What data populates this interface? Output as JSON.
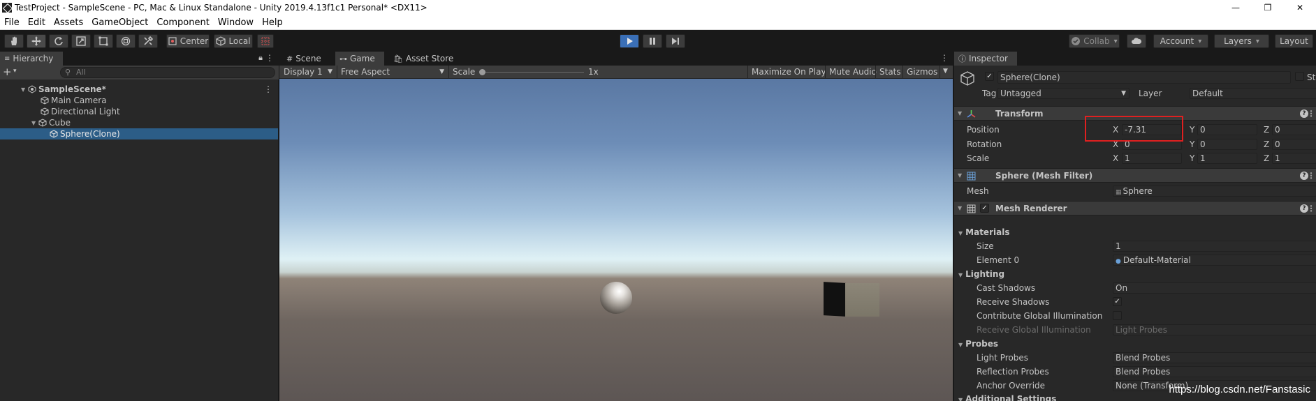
{
  "window": {
    "title": "TestProject - SampleScene - PC, Mac & Linux Standalone - Unity 2019.4.13f1c1 Personal* <DX11>",
    "minimize": "—",
    "restore": "❐",
    "close": "✕"
  },
  "menu": [
    "File",
    "Edit",
    "Assets",
    "GameObject",
    "Component",
    "Window",
    "Help"
  ],
  "toolbar": {
    "pivot_label": "Center",
    "space_label": "Local",
    "collab_label": "Collab",
    "account_label": "Account",
    "layers_label": "Layers",
    "layout_label": "Layout"
  },
  "hierarchy": {
    "tab_label": "Hierarchy",
    "search_placeholder": "All",
    "items": [
      {
        "label": "SampleScene*",
        "depth": 0
      },
      {
        "label": "Main Camera",
        "depth": 1
      },
      {
        "label": "Directional Light",
        "depth": 1
      },
      {
        "label": "Cube",
        "depth": 1
      },
      {
        "label": "Sphere(Clone)",
        "depth": 2,
        "selected": true
      }
    ]
  },
  "center": {
    "tabs": [
      "Scene",
      "Game",
      "Asset Store"
    ],
    "display": "Display 1",
    "aspect": "Free Aspect",
    "scale_label": "Scale",
    "scale_value": "1x",
    "maximize": "Maximize On Play",
    "mute": "Mute Audio",
    "stats": "Stats",
    "gizmos": "Gizmos"
  },
  "inspector": {
    "tab_label": "Inspector",
    "object_name": "Sphere(Clone)",
    "static_label": "St",
    "tag_label": "Tag",
    "tag_value": "Untagged",
    "layer_label": "Layer",
    "layer_value": "Default",
    "transform": {
      "title": "Transform",
      "position_label": "Position",
      "rotation_label": "Rotation",
      "scale_label": "Scale",
      "axis_x": "X",
      "axis_y": "Y",
      "axis_z": "Z",
      "position": [
        "-7.31",
        "0",
        "0"
      ],
      "rotation": [
        "0",
        "0",
        "0"
      ],
      "scale": [
        "1",
        "1",
        "1"
      ]
    },
    "mesh_filter": {
      "title": "Sphere (Mesh Filter)",
      "mesh_label": "Mesh",
      "mesh_value": "Sphere"
    },
    "mesh_renderer": {
      "title": "Mesh Renderer",
      "materials_label": "Materials",
      "size_label": "Size",
      "size_value": "1",
      "element0_label": "Element 0",
      "element0_value": "Default-Material",
      "lighting_label": "Lighting",
      "cast_shadows_label": "Cast Shadows",
      "cast_shadows_value": "On",
      "receive_shadows_label": "Receive Shadows",
      "contribute_gi_label": "Contribute Global Illumination",
      "receive_gi_label": "Receive Global Illumination",
      "receive_gi_value": "Light Probes",
      "probes_label": "Probes",
      "light_probes_label": "Light Probes",
      "light_probes_value": "Blend Probes",
      "reflection_probes_label": "Reflection Probes",
      "reflection_probes_value": "Blend Probes",
      "anchor_override_label": "Anchor Override",
      "anchor_override_value": "None (Transform)",
      "additional_settings_label": "Additional Settings"
    }
  },
  "watermark": "https://blog.csdn.net/Fanstasic",
  "colors": {
    "highlight": "#e02020",
    "selection": "#2c5d87",
    "play_active": "#3a6fb7"
  }
}
